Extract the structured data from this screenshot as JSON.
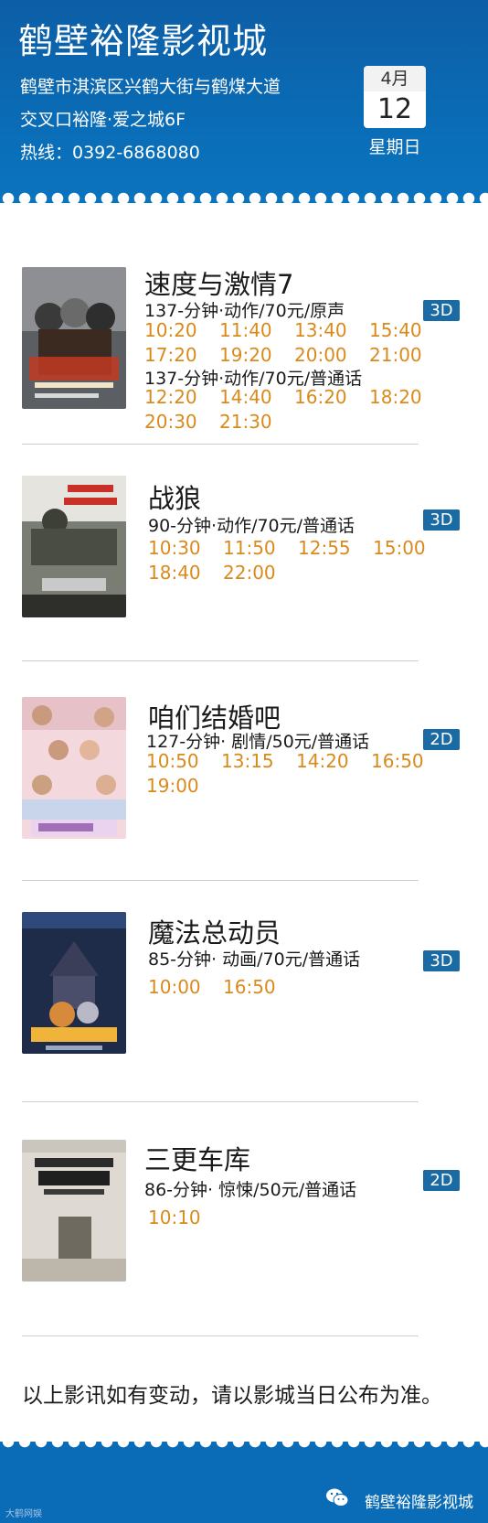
{
  "header": {
    "title": "鹤壁裕隆影视城",
    "address_line1": "鹤壁市淇滨区兴鹤大街与鹤煤大道",
    "address_line2": "交叉口裕隆·爱之城6F",
    "hotline": "热线：0392-6868080",
    "calendar": {
      "month": "4月",
      "day": "12",
      "weekday": "星期日"
    }
  },
  "movies": [
    {
      "title": "速度与激情7",
      "badge": "3D",
      "sessions": [
        {
          "info": "137-分钟·动作/70元/原声",
          "times": [
            "10:20",
            "11:40",
            "13:40",
            "15:40",
            "17:20",
            "19:20",
            "20:00",
            "21:00"
          ]
        },
        {
          "info": "137-分钟·动作/70元/普通话",
          "times": [
            "12:20",
            "14:40",
            "16:20",
            "18:20",
            "20:30",
            "21:30"
          ]
        }
      ]
    },
    {
      "title": "战狼",
      "badge": "3D",
      "sessions": [
        {
          "info": "90-分钟·动作/70元/普通话",
          "times": [
            "10:30",
            "11:50",
            "12:55",
            "15:00",
            "18:40",
            "22:00"
          ]
        }
      ]
    },
    {
      "title": "咱们结婚吧",
      "badge": "2D",
      "sessions": [
        {
          "info": "127-分钟· 剧情/50元/普通话",
          "times": [
            "10:50",
            "13:15",
            "14:20",
            "16:50",
            "19:00"
          ]
        }
      ]
    },
    {
      "title": "魔法总动员",
      "badge": "3D",
      "sessions": [
        {
          "info": "85-分钟· 动画/70元/普通话",
          "times": [
            "10:00",
            "16:50"
          ]
        }
      ]
    },
    {
      "title": "三更车库",
      "badge": "2D",
      "sessions": [
        {
          "info": "86-分钟· 惊悚/50元/普通话",
          "times": [
            "10:10"
          ]
        }
      ]
    }
  ],
  "notice": "以上影讯如有变动，请以影城当日公布为准。",
  "footer": {
    "brand": "鹤壁裕隆影视城",
    "watermark": "大鹤网娱"
  },
  "colors": {
    "header_bg": "#0a6cb6",
    "time_text": "#d98a1c",
    "badge_bg": "#1a6aa3"
  }
}
